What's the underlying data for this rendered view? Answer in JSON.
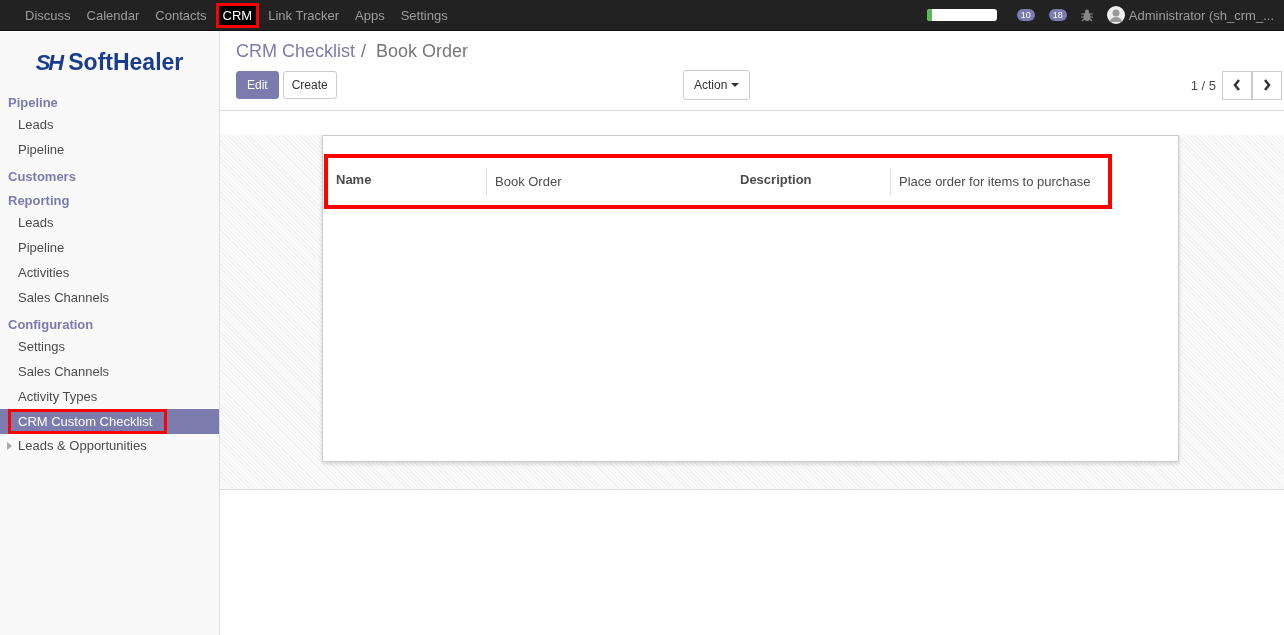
{
  "top_menu": [
    {
      "label": "Discuss",
      "selected": false,
      "highlighted": false
    },
    {
      "label": "Calendar",
      "selected": false,
      "highlighted": false
    },
    {
      "label": "Contacts",
      "selected": false,
      "highlighted": false
    },
    {
      "label": "CRM",
      "selected": true,
      "highlighted": true
    },
    {
      "label": "Link Tracker",
      "selected": false,
      "highlighted": false
    },
    {
      "label": "Apps",
      "selected": false,
      "highlighted": false
    },
    {
      "label": "Settings",
      "selected": false,
      "highlighted": false
    }
  ],
  "systray": {
    "progress": {
      "level": 0.07
    },
    "activity_count": "10",
    "message_count": "18",
    "user": "Administrator (sh_crm_..."
  },
  "logo": {
    "mark": "SH",
    "name": "SoftHealer"
  },
  "sidebar": [
    {
      "kind": "heading",
      "label": "Pipeline"
    },
    {
      "kind": "item",
      "label": "Leads",
      "selected": false,
      "highlighted": false
    },
    {
      "kind": "item",
      "label": "Pipeline",
      "selected": false,
      "highlighted": false
    },
    {
      "kind": "heading",
      "label": "Customers"
    },
    {
      "kind": "heading",
      "label": "Reporting"
    },
    {
      "kind": "item",
      "label": "Leads",
      "selected": false,
      "highlighted": false
    },
    {
      "kind": "item",
      "label": "Pipeline",
      "selected": false,
      "highlighted": false
    },
    {
      "kind": "item",
      "label": "Activities",
      "selected": false,
      "highlighted": false
    },
    {
      "kind": "item",
      "label": "Sales Channels",
      "selected": false,
      "highlighted": false
    },
    {
      "kind": "heading",
      "label": "Configuration"
    },
    {
      "kind": "item",
      "label": "Settings",
      "selected": false,
      "highlighted": false
    },
    {
      "kind": "item",
      "label": "Sales Channels",
      "selected": false,
      "highlighted": false
    },
    {
      "kind": "item",
      "label": "Activity Types",
      "selected": false,
      "highlighted": false
    },
    {
      "kind": "item",
      "label": "CRM Custom Checklist",
      "selected": true,
      "highlighted": true
    },
    {
      "kind": "folder",
      "label": "Leads & Opportunities",
      "expanded": false
    }
  ],
  "breadcrumb": [
    {
      "label": "CRM Checklist"
    },
    {
      "label": "Book Order"
    }
  ],
  "breadcrumb_separator": "/",
  "buttons": {
    "edit": "Edit",
    "create": "Create",
    "action": "Action"
  },
  "pager": "1 / 5",
  "form": {
    "highlighted": true,
    "fields": [
      {
        "label": "Name",
        "value": "Book Order"
      },
      {
        "label": "Description",
        "value": "Place order for items to purchase"
      }
    ]
  }
}
